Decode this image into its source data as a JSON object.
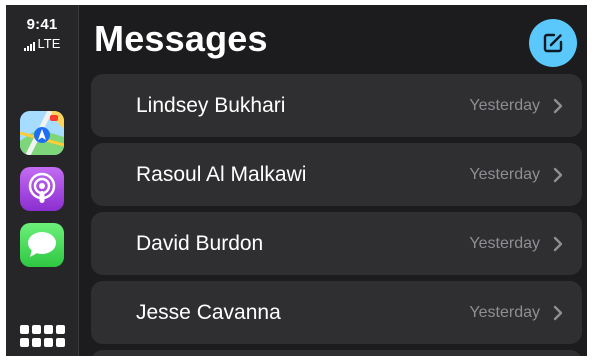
{
  "status": {
    "time": "9:41",
    "network": "LTE"
  },
  "dock": {
    "apps": [
      {
        "name": "Maps",
        "icon": "maps-icon"
      },
      {
        "name": "Podcasts",
        "icon": "podcasts-icon"
      },
      {
        "name": "Messages",
        "icon": "messages-icon"
      }
    ],
    "launcher_icon": "app-grid-icon"
  },
  "header": {
    "title": "Messages",
    "compose_icon": "compose-icon"
  },
  "conversations": [
    {
      "name": "Lindsey Bukhari",
      "time": "Yesterday"
    },
    {
      "name": "Rasoul Al Malkawi",
      "time": "Yesterday"
    },
    {
      "name": "David Burdon",
      "time": "Yesterday"
    },
    {
      "name": "Jesse Cavanna",
      "time": "Yesterday"
    }
  ],
  "colors": {
    "accent": "#5ac8fa",
    "background": "#1c1c1e",
    "row": "#2f2f31",
    "secondary_text": "#8e8e93"
  }
}
